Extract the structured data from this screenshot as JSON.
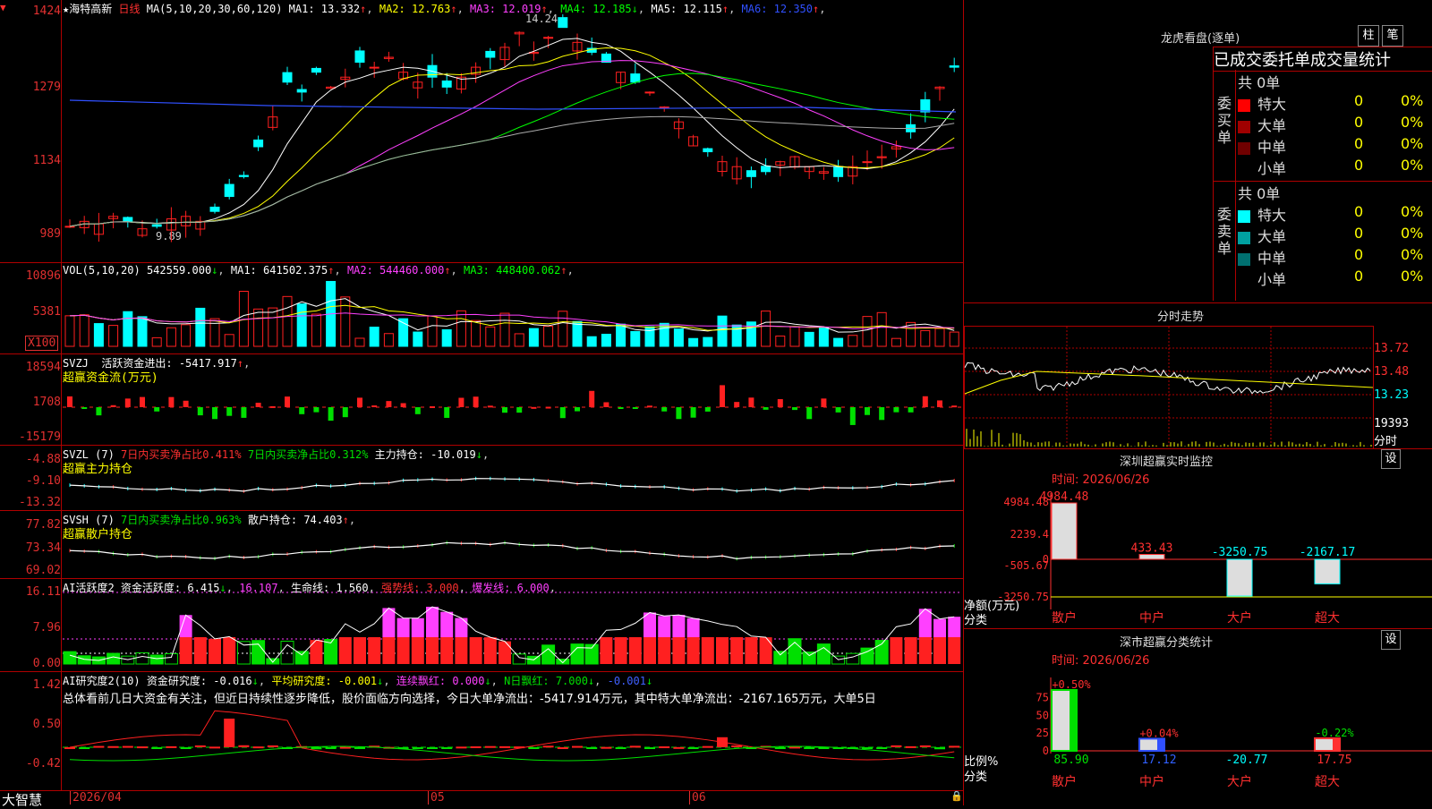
{
  "stock": {
    "name": "★海特高新",
    "period": "日线",
    "ma_header": {
      "label": "MA(5,10,20,30,60,120)",
      "items": [
        {
          "k": "MA1",
          "v": "13.332",
          "a": "↑",
          "c": "#ffffff"
        },
        {
          "k": "MA2",
          "v": "12.763",
          "a": "↑",
          "c": "#ffff00"
        },
        {
          "k": "MA3",
          "v": "12.019",
          "a": "↑",
          "c": "#ff40ff"
        },
        {
          "k": "MA4",
          "v": "12.185",
          "a": "↓",
          "c": "#00ff00"
        },
        {
          "k": "MA5",
          "v": "12.115",
          "a": "↑",
          "c": "#ffffff"
        },
        {
          "k": "MA6",
          "v": "12.350",
          "a": "↑",
          "c": "#3050ff"
        }
      ]
    },
    "high_label": "14.24",
    "low_label": "9.89"
  },
  "price_axis": [
    "1424",
    "1279",
    "1134",
    "989"
  ],
  "vol": {
    "header": "VOL(5,10,20)",
    "value": "542559.000",
    "arrow": "↓",
    "items": [
      {
        "k": "MA1",
        "v": "641502.375",
        "a": "↑",
        "c": "#ffffff"
      },
      {
        "k": "MA2",
        "v": "544460.000",
        "a": "↑",
        "c": "#ff40ff"
      },
      {
        "k": "MA3",
        "v": "448400.062",
        "a": "↑",
        "c": "#00ff00"
      }
    ],
    "axis": [
      "10896",
      "5381"
    ],
    "unit": "X100"
  },
  "svzj": {
    "header": "SVZJ",
    "label": "活跃资金进出:",
    "value": "-5417.917",
    "arrow": "↑",
    "sub": "超赢资金流(万元)",
    "axis": [
      "18594",
      "1708",
      "-15179"
    ]
  },
  "svzl": {
    "header": "SVZL (7)",
    "l1": "7日内买卖净占比0.411%",
    "l2": "7日内买卖净占比0.312%",
    "l3": "主力持仓:",
    "v": "-10.019",
    "arrow": "↓",
    "sub": "超赢主力持仓",
    "axis": [
      "-4.88",
      "-9.10",
      "-13.32"
    ]
  },
  "svsh": {
    "header": "SVSH (7)",
    "l1": "7日内买卖净占比0.963%",
    "l2": "散户持仓:",
    "v": "74.403",
    "arrow": "↑",
    "sub": "超赢散户持仓",
    "axis": [
      "77.82",
      "73.34",
      "69.02"
    ]
  },
  "ai1": {
    "header": "AI活跃度2",
    "l1": "资金活跃度:",
    "v1": "6.415",
    "a1": "↓",
    "v2": "16.107",
    "l3": "生命线:",
    "v3": "1.560",
    "l4": "强势线:",
    "v4": "3.000",
    "l5": "爆发线:",
    "v5": "6.000",
    "axis": [
      "16.11",
      "7.96",
      "0.00"
    ]
  },
  "ai2": {
    "header": "AI研究度2(10)",
    "l1": "资金研究度:",
    "v1": "-0.016",
    "a1": "↓",
    "l2": "平均研究度:",
    "v2": "-0.001",
    "a2": "↓",
    "l3": "连续飘红:",
    "v3": "0.000",
    "a3": "↓",
    "l4": "N日飘红:",
    "v4": "7.000",
    "a4": "↓",
    "v5": "-0.001",
    "a5": "↓",
    "commentary": "总体看前几日大资金有关注，但近日持续性逐步降低，股价面临方向选择，今日大单净流出：-5417.914万元，其中特大单净流出：-2167.165万元，大单5日",
    "axis": [
      "1.42",
      "0.50",
      "-0.42"
    ]
  },
  "bottom": {
    "brand": "大智慧",
    "dates": [
      "2026/04",
      "05",
      "06"
    ]
  },
  "right": {
    "lhb_title": "龙虎看盘(逐单)",
    "buttons": [
      "柱",
      "笔"
    ],
    "tabs_text": "已成交委托单成交量统计",
    "buy": {
      "side": "委买单",
      "total": "共 0单",
      "rows": [
        {
          "name": "特大",
          "c": "#ff0000",
          "n": "0",
          "p": "0%"
        },
        {
          "name": "大单",
          "c": "#a00000",
          "n": "0",
          "p": "0%"
        },
        {
          "name": "中单",
          "c": "#700000",
          "n": "0",
          "p": "0%"
        },
        {
          "name": "小单",
          "c": "",
          "n": "0",
          "p": "0%"
        }
      ]
    },
    "sell": {
      "side": "委卖单",
      "total": "共 0单",
      "rows": [
        {
          "name": "特大",
          "c": "#00ffff",
          "n": "0",
          "p": "0%"
        },
        {
          "name": "大单",
          "c": "#00a0a0",
          "n": "0",
          "p": "0%"
        },
        {
          "name": "中单",
          "c": "#007070",
          "n": "0",
          "p": "0%"
        },
        {
          "name": "小单",
          "c": "",
          "n": "0",
          "p": "0%"
        }
      ]
    },
    "intraday": {
      "title": "分时走势",
      "axis": [
        "13.72",
        "13.48",
        "13.23",
        "19393"
      ],
      "unit": "分时"
    },
    "sz_monitor": {
      "title": "深圳超赢实时监控",
      "btn": "设",
      "time": "时间: 2026/06/26",
      "axis": [
        "4984.48",
        "2239.4",
        "0",
        "-505.67",
        "-3250.75"
      ],
      "ylab1": "净额(万元)",
      "ylab2": "分类",
      "bars": [
        {
          "cat": "散户",
          "v": "4984.48",
          "val": 4984.48
        },
        {
          "cat": "中户",
          "v": "433.43",
          "val": 433.43
        },
        {
          "cat": "大户",
          "v": "-3250.75",
          "val": -3250.75
        },
        {
          "cat": "超大",
          "v": "-2167.17",
          "val": -2167.17
        }
      ]
    },
    "sz_class": {
      "title": "深市超赢分类统计",
      "btn": "设",
      "time": "时间: 2026/06/26",
      "axis": [
        "75",
        "50",
        "25",
        "0"
      ],
      "ylab1": "比例%",
      "ylab2": "分类",
      "bars": [
        {
          "cat": "散户",
          "top": "+0.50%",
          "bot": "85.90",
          "val": 85.9
        },
        {
          "cat": "中户",
          "top": "+0.04%",
          "bot": "17.12",
          "val": 17.12
        },
        {
          "cat": "大户",
          "top": "",
          "bot": "-20.77",
          "val": 0
        },
        {
          "cat": "超大",
          "top": "-0.22%",
          "bot": "17.75",
          "val": 17.75
        }
      ]
    }
  },
  "colors": {
    "up": "#ff2020",
    "down": "#00ffff",
    "grid": "#b00000",
    "axis": "#e23030"
  }
}
